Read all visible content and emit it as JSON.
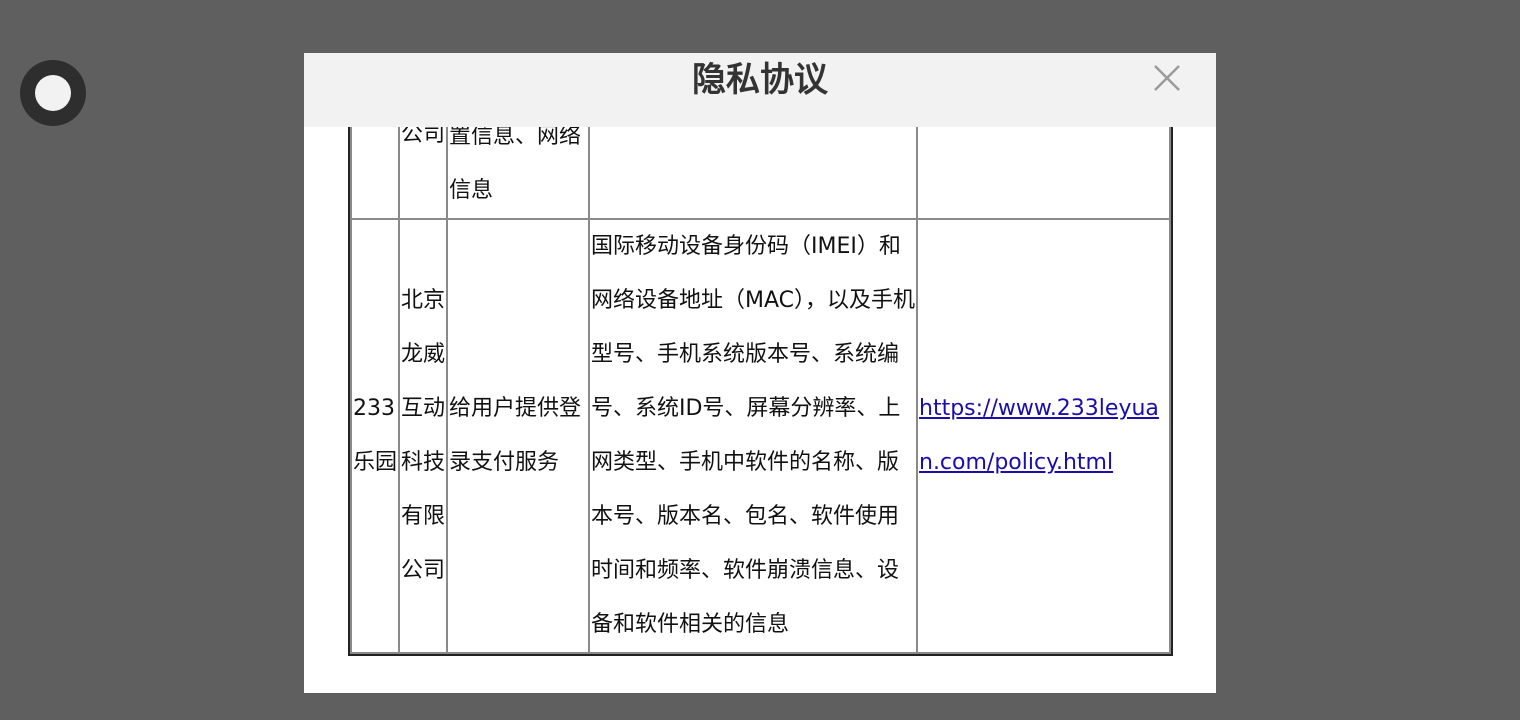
{
  "dialog": {
    "title": "隐私协议"
  },
  "table": {
    "prev_row": {
      "c1": "",
      "c2": "公司",
      "c3": "置信息、网络信息",
      "c4": "",
      "c5": ""
    },
    "row": {
      "sdk_name": "233乐园",
      "company": "北京龙威互动科技有限公司",
      "purpose": "给用户提供登录支付服务",
      "data_collected": "国际移动设备身份码（IMEI）和网络设备地址（MAC），以及手机型号、手机系统版本号、系统编号、系统ID号、屏幕分辨率、上网类型、手机中软件的名称、版本号、版本名、包名、软件使用时间和频率、软件崩溃信息、设备和软件相关的信息",
      "policy_url": "https://www.233leyuan.com/policy.html"
    }
  },
  "icons": {
    "close": "close-icon",
    "floating": "floating-ball-icon"
  }
}
